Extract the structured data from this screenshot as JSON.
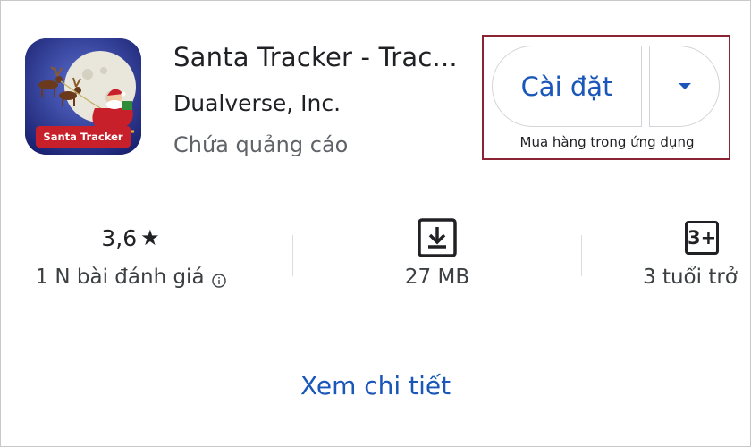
{
  "app": {
    "icon_name": "santa-sleigh-icon",
    "icon_caption": "Santa Tracker",
    "title": "Santa Tracker - Trac...",
    "developer": "Dualverse, Inc.",
    "ads_notice": "Chứa quảng cáo"
  },
  "install": {
    "label": "Cài đặt",
    "dropdown_icon": "caret-down-icon",
    "in_app_purchase_note": "Mua hàng trong ứng dụng",
    "accent_color": "#1a57b8",
    "highlight_color": "#8b2432"
  },
  "stats": {
    "rating": {
      "value": "3,6",
      "star_glyph": "★",
      "reviews_label": "1 N bài đánh giá",
      "info_icon": "info-icon"
    },
    "size": {
      "icon": "download-icon",
      "label": "27 MB"
    },
    "age": {
      "badge": "3+",
      "label": "3 tuổi trở"
    }
  },
  "details_link": "Xem chi tiết"
}
